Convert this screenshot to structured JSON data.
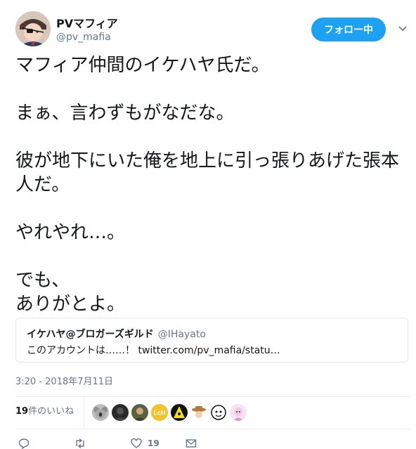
{
  "user": {
    "name": "PVマフィア",
    "handle": "@pv_mafia"
  },
  "follow_button": {
    "label": "フォロー中",
    "color": "#1da1f2"
  },
  "tweet": {
    "paragraphs": [
      "マフィア仲間のイケハヤ氏だ。",
      "まぁ、言わずもがなだな。",
      "彼が地下にいた俺を地上に引っ張りあげた張本人だ。",
      "やれやれ…。",
      "でも、\nありがとよ。"
    ]
  },
  "quoted_tweet": {
    "author": "イケハヤ@ブロガーズギルド",
    "handle": "@IHayato",
    "text": "このアカウントは……！ twitter.com/pv_mafia/statu…"
  },
  "timestamp": "3:20 - 2018年7月11日",
  "stats": {
    "likes_count": "19",
    "likes_label": "件のいいね"
  },
  "likers": [
    {
      "icon": "koala-avatar",
      "color": "#b8b8b8"
    },
    {
      "icon": "dark-portrait-avatar",
      "color": "#3a3a3a"
    },
    {
      "icon": "person-photo-avatar",
      "color": "#6b6f4a"
    },
    {
      "icon": "lch-logo-avatar",
      "color": "#f3c12b"
    },
    {
      "icon": "yellow-character-avatar",
      "color": "#f7e21a"
    },
    {
      "icon": "cowboy-illustration-avatar",
      "color": "#d9a46a"
    },
    {
      "icon": "ghost-illustration-avatar",
      "color": "#ffffff"
    },
    {
      "icon": "pink-character-avatar",
      "color": "#f2c8e6"
    }
  ],
  "actions": {
    "reply_icon": "reply-icon",
    "retweet_icon": "retweet-icon",
    "like_icon": "heart-icon",
    "like_count": "19",
    "dm_icon": "envelope-icon"
  }
}
